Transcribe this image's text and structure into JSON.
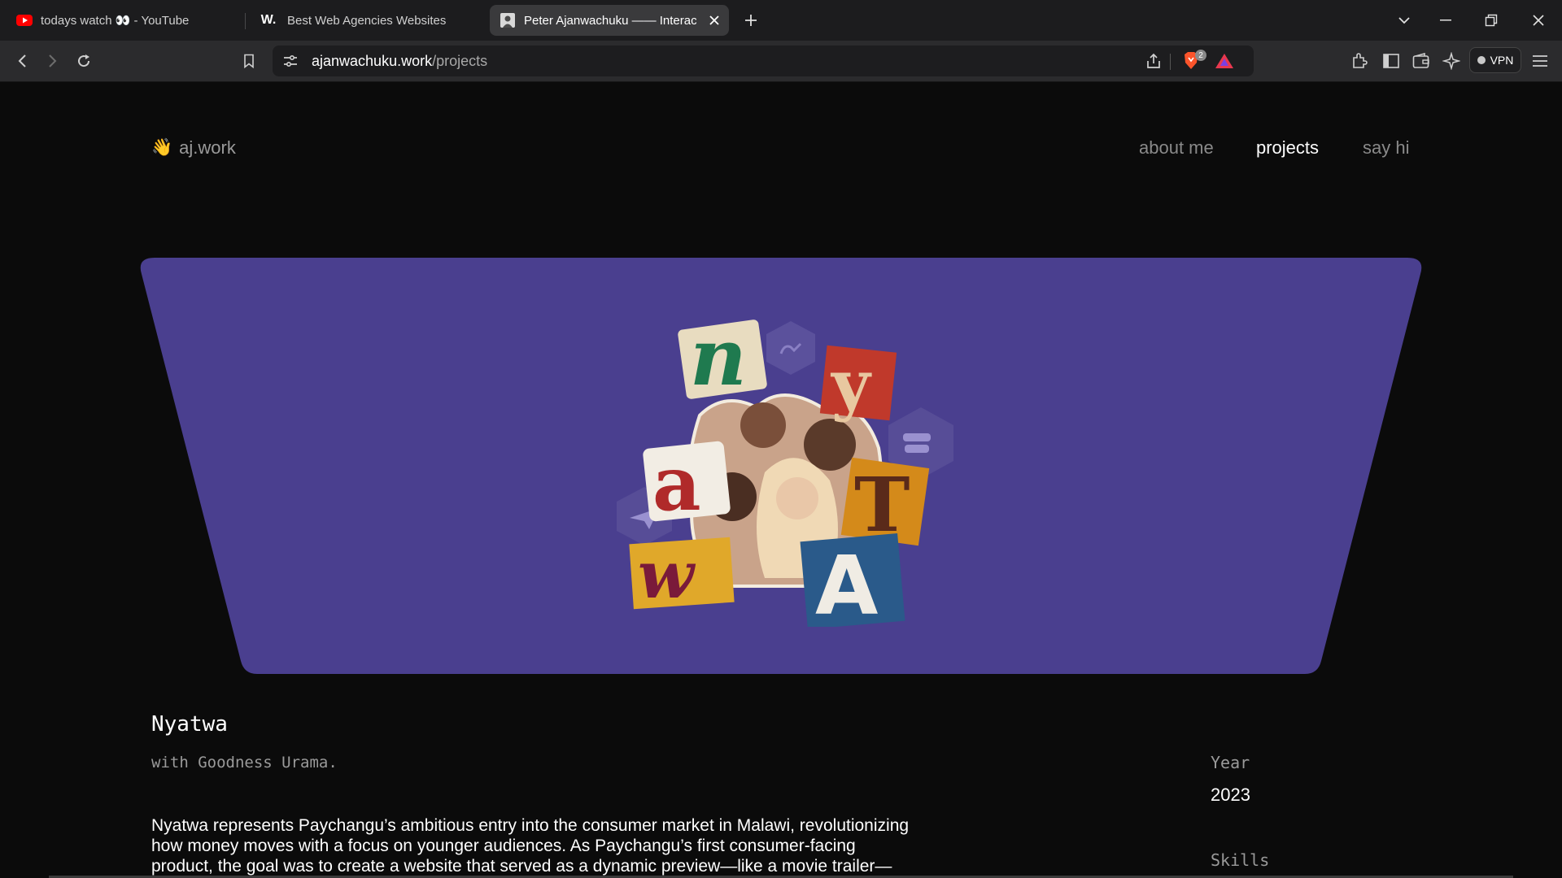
{
  "browser": {
    "tabs": [
      {
        "title": "todays watch 👀 - YouTube",
        "icon": "youtube-icon",
        "active": false
      },
      {
        "title": "Best Web Agencies Websites",
        "icon": "w-logo-icon",
        "favicon_text": "W.",
        "active": false
      },
      {
        "title": "Peter Ajanwachuku —— Interact",
        "icon": "portrait-favicon-icon",
        "active": true
      }
    ],
    "address": {
      "domain": "ajanwachuku.work",
      "path": "/projects"
    },
    "shield_count": "2",
    "vpn_label": "VPN",
    "accent": "#1a73e8"
  },
  "site": {
    "logo_emoji": "👋",
    "logo_text": "aj.work",
    "nav": [
      {
        "label": "about me",
        "active": false
      },
      {
        "label": "projects",
        "active": true
      },
      {
        "label": "say hi",
        "active": false
      }
    ]
  },
  "hero": {
    "background": "#4a3f8f",
    "collage_letters": [
      "n",
      "y",
      "a",
      "T",
      "w",
      "A"
    ]
  },
  "project": {
    "title": "Nyatwa",
    "subtitle": "with Goodness Urama.",
    "description_lines": [
      "Nyatwa represents Paychangu’s ambitious entry into the consumer market in Malawi, revolutionizing",
      "how money moves with a focus on younger audiences. As Paychangu’s first consumer-facing",
      "product, the goal was to create a website that served as a dynamic preview—like a movie trailer—"
    ],
    "meta": {
      "year_label": "Year",
      "year_value": "2023",
      "skills_label": "Skills"
    }
  }
}
